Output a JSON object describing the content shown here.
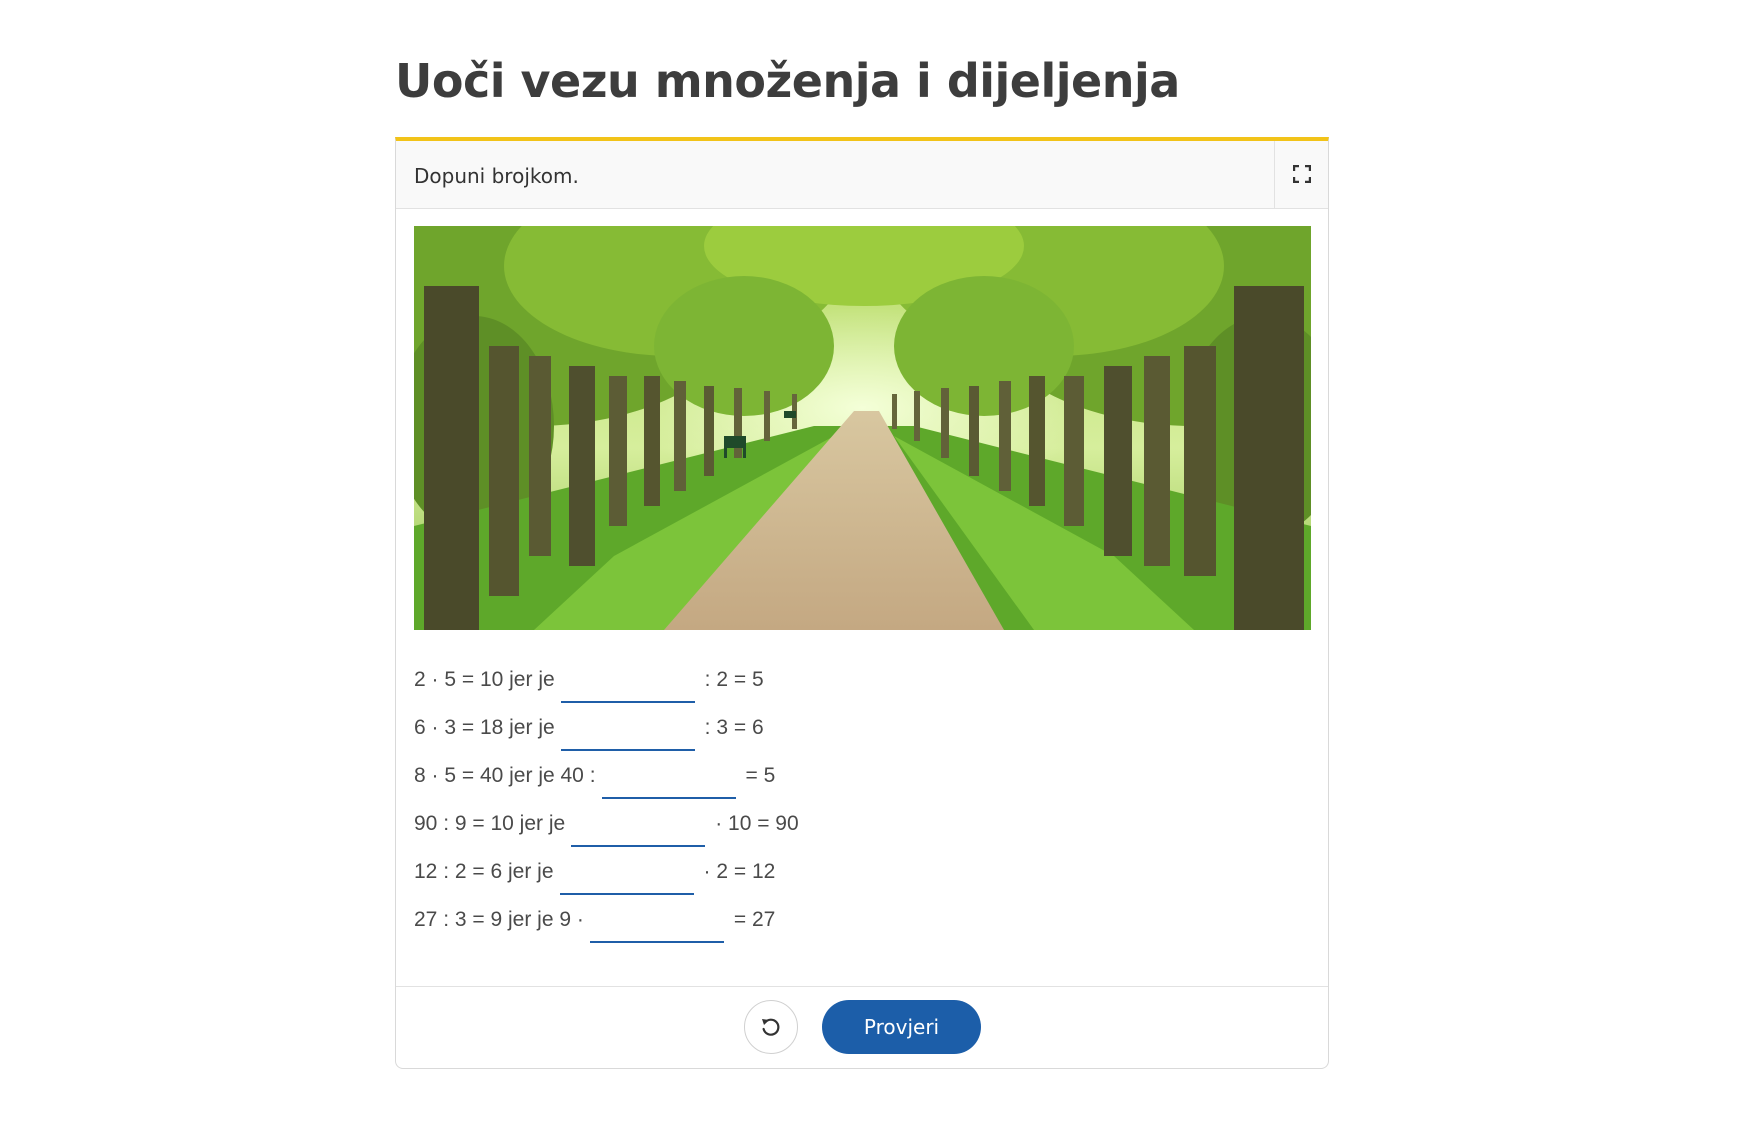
{
  "page": {
    "title": "Uoči vezu množenja i dijeljenja"
  },
  "exercise": {
    "instruction": "Dopuni brojkom.",
    "fullscreen_icon": "fullscreen-icon",
    "image_alt": "tree-lined park avenue",
    "tasks": [
      {
        "before": "2 · 5 = 10 jer je",
        "after": ": 2 = 5",
        "value": ""
      },
      {
        "before": "6 · 3 = 18 jer je",
        "after": ": 3 = 6",
        "value": ""
      },
      {
        "before": "8 · 5 = 40 jer je 40 :",
        "after": "= 5",
        "value": ""
      },
      {
        "before": "90 : 9 = 10 jer je",
        "after": "· 10 = 90",
        "value": ""
      },
      {
        "before": "12 : 2 = 6 jer je",
        "after": "· 2 = 12",
        "value": ""
      },
      {
        "before": "27 : 3 = 9 jer je 9 ·",
        "after": "= 27",
        "value": ""
      }
    ]
  },
  "footer": {
    "reset_icon": "reset-icon",
    "check_label": "Provjeri"
  },
  "colors": {
    "accent_border": "#f2c318",
    "primary_button": "#1c5ea9",
    "blank_underline": "#1f5ea8"
  }
}
